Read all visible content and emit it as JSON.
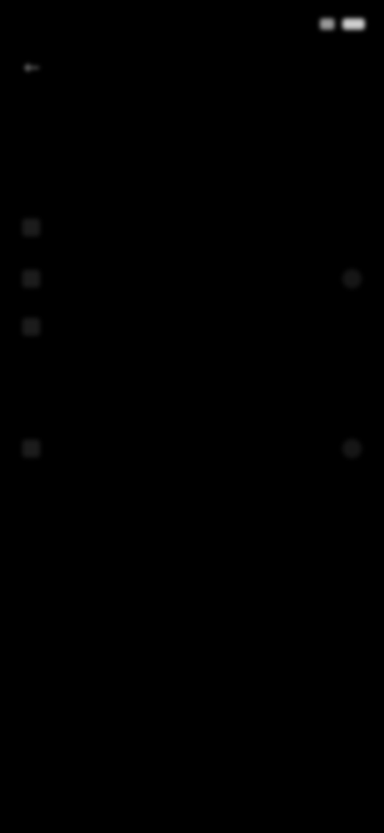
{
  "status_bar": {
    "time": "",
    "icons": [
      "wifi-icon",
      "battery-icon"
    ]
  },
  "header": {
    "back_icon": "arrow-left-icon",
    "title": ""
  },
  "sections": [
    {
      "title": "",
      "items": [
        {
          "label": "",
          "icon": "settings-icon",
          "trailing": ""
        },
        {
          "label": "",
          "icon": "settings-icon",
          "trailing": "chevron-right-icon"
        },
        {
          "label": "",
          "icon": "settings-icon",
          "trailing": ""
        }
      ]
    },
    {
      "title": "",
      "items": [
        {
          "label": "",
          "icon": "settings-icon",
          "trailing": "toggle-icon",
          "sublabel": ""
        }
      ]
    }
  ],
  "colors": {
    "background": "#000000",
    "text_primary": "#cfcfcf",
    "text_secondary": "#8e8e8e"
  }
}
